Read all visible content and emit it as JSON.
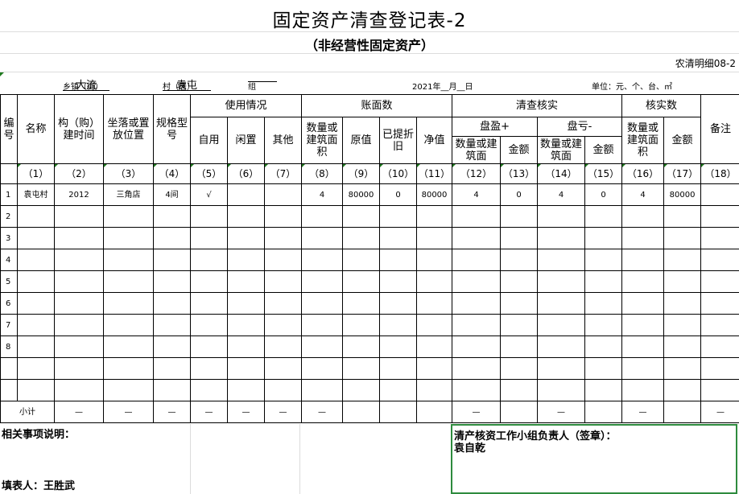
{
  "title": "固定资产清查登记表-2",
  "subtitle": "（非经营性固定资产）",
  "form_code": "农清明细08-2",
  "info": {
    "town_value": "大流",
    "town_label": "乡镇（街）",
    "village_value": "袁屯",
    "village_label": "村（居）",
    "group_value": "",
    "group_label": "组",
    "date": "2021年__月__日",
    "unit_label": "单位：元、个、台、㎡"
  },
  "headers": {
    "no": "编号",
    "name": "名称",
    "build_time": "构（购）建时间",
    "location": "坐落或置放位置",
    "spec": "规格型号",
    "usage": "使用情况",
    "self_use": "自用",
    "idle": "闲置",
    "other": "其他",
    "book": "账面数",
    "book_qty": "数量或建筑面积",
    "orig_value": "原值",
    "depreciation": "已提折旧",
    "net_value": "净值",
    "check": "清查核实",
    "surplus": "盘盈+",
    "deficit": "盘亏-",
    "check_qty": "数量或建筑面",
    "check_amount": "金额",
    "verified": "核实数",
    "ver_qty": "数量或建筑面积",
    "ver_amount": "金额",
    "remark": "备注"
  },
  "index_row": [
    "（1）",
    "（2）",
    "（3）",
    "（4）",
    "（5）",
    "（6）",
    "（7）",
    "（8）",
    "（9）",
    "（10）",
    "（11）",
    "（12）",
    "（13）",
    "（14）",
    "（15）",
    "（16）",
    "（17）",
    "（18）"
  ],
  "rows": [
    [
      "1",
      "袁屯村",
      "2012",
      "三角店",
      "4间",
      "√",
      "",
      "",
      "4",
      "80000",
      "0",
      "80000",
      "4",
      "0",
      "4",
      "0",
      "4",
      "80000",
      ""
    ],
    [
      "2",
      "",
      "",
      "",
      "",
      "",
      "",
      "",
      "",
      "",
      "",
      "",
      "",
      "",
      "",
      "",
      "",
      "",
      ""
    ],
    [
      "3",
      "",
      "",
      "",
      "",
      "",
      "",
      "",
      "",
      "",
      "",
      "",
      "",
      "",
      "",
      "",
      "",
      "",
      ""
    ],
    [
      "4",
      "",
      "",
      "",
      "",
      "",
      "",
      "",
      "",
      "",
      "",
      "",
      "",
      "",
      "",
      "",
      "",
      "",
      ""
    ],
    [
      "5",
      "",
      "",
      "",
      "",
      "",
      "",
      "",
      "",
      "",
      "",
      "",
      "",
      "",
      "",
      "",
      "",
      "",
      ""
    ],
    [
      "6",
      "",
      "",
      "",
      "",
      "",
      "",
      "",
      "",
      "",
      "",
      "",
      "",
      "",
      "",
      "",
      "",
      "",
      ""
    ],
    [
      "7",
      "",
      "",
      "",
      "",
      "",
      "",
      "",
      "",
      "",
      "",
      "",
      "",
      "",
      "",
      "",
      "",
      "",
      ""
    ],
    [
      "8",
      "",
      "",
      "",
      "",
      "",
      "",
      "",
      "",
      "",
      "",
      "",
      "",
      "",
      "",
      "",
      "",
      "",
      ""
    ],
    [
      "",
      "",
      "",
      "",
      "",
      "",
      "",
      "",
      "",
      "",
      "",
      "",
      "",
      "",
      "",
      "",
      "",
      "",
      ""
    ],
    [
      "",
      "",
      "",
      "",
      "",
      "",
      "",
      "",
      "",
      "",
      "",
      "",
      "",
      "",
      "",
      "",
      "",
      "",
      ""
    ]
  ],
  "subtotal": [
    "小计",
    "—",
    "—",
    "—",
    "—",
    "—",
    "—",
    "—",
    "",
    "",
    "",
    "—",
    "",
    "—",
    "",
    "—",
    "",
    "—"
  ],
  "bottom": {
    "remarks_label": "相关事项说明：",
    "filler_label": "填表人：王胜武",
    "sign_label": "清产核资工作小组负责人（签章）：",
    "sign_name": "袁自乾"
  }
}
